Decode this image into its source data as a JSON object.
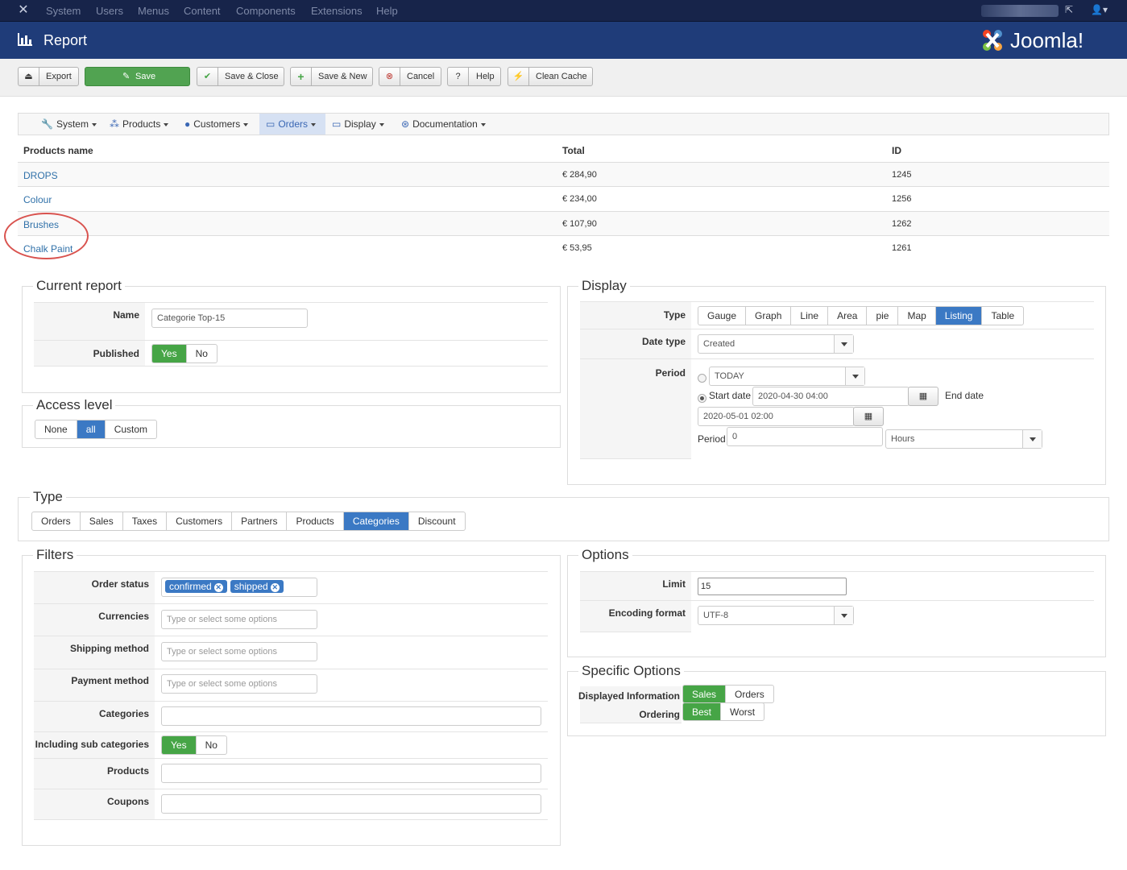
{
  "topnav": {
    "menu": [
      "System",
      "Users",
      "Menus",
      "Content",
      "Components",
      "Extensions",
      "Help"
    ]
  },
  "header": {
    "title": "Report"
  },
  "toolbar": {
    "export": "Export",
    "save": "Save",
    "save_close": "Save & Close",
    "save_new": "Save & New",
    "cancel": "Cancel",
    "help": "Help",
    "clean_cache": "Clean Cache"
  },
  "subnav": {
    "items": [
      "System",
      "Products",
      "Customers",
      "Orders",
      "Display",
      "Documentation"
    ],
    "active": "Orders"
  },
  "table": {
    "headers": [
      "Products name",
      "Total",
      "ID"
    ],
    "rows": [
      {
        "name": "DROPS",
        "total": "€ 284,90",
        "id": "1245"
      },
      {
        "name": "Colour",
        "total": "€ 234,00",
        "id": "1256"
      },
      {
        "name": "Brushes",
        "total": "€ 107,90",
        "id": "1262"
      },
      {
        "name": "Chalk Paint",
        "total": "€ 53,95",
        "id": "1261"
      }
    ]
  },
  "current_report": {
    "legend": "Current report",
    "name_label": "Name",
    "name_value": "Categorie Top-15",
    "published_label": "Published",
    "yes": "Yes",
    "no": "No"
  },
  "access_level": {
    "legend": "Access level",
    "options": [
      "None",
      "all",
      "Custom"
    ],
    "selected": "all"
  },
  "display": {
    "legend": "Display",
    "type_label": "Type",
    "types": [
      "Gauge",
      "Graph",
      "Line",
      "Area",
      "pie",
      "Map",
      "Listing",
      "Table"
    ],
    "selected_type": "Listing",
    "date_type_label": "Date type",
    "date_type_value": "Created",
    "period_label": "Period",
    "today": "TODAY",
    "start_date_label": "Start date",
    "start_date": "2020-04-30 04:00",
    "end_date_label": "End date",
    "end_date": "2020-05-01 02:00",
    "period_value_label": "Period",
    "period_value": "0",
    "period_unit": "Hours"
  },
  "type": {
    "legend": "Type",
    "options": [
      "Orders",
      "Sales",
      "Taxes",
      "Customers",
      "Partners",
      "Products",
      "Categories",
      "Discount"
    ],
    "selected": "Categories"
  },
  "filters": {
    "legend": "Filters",
    "order_status_label": "Order status",
    "order_status_tags": [
      "confirmed",
      "shipped"
    ],
    "currencies_label": "Currencies",
    "shipping_label": "Shipping method",
    "payment_label": "Payment method",
    "placeholder": "Type or select some options",
    "categories_label": "Categories",
    "sub_categories_label": "Including sub categories",
    "yes": "Yes",
    "no": "No",
    "products_label": "Products",
    "coupons_label": "Coupons"
  },
  "options": {
    "legend": "Options",
    "limit_label": "Limit",
    "limit_value": "15",
    "encoding_label": "Encoding format",
    "encoding_value": "UTF-8"
  },
  "specific": {
    "legend": "Specific Options",
    "displayed_label": "Displayed Information",
    "displayed": [
      "Sales",
      "Orders"
    ],
    "ordering_label": "Ordering",
    "ordering": [
      "Best",
      "Worst"
    ]
  }
}
